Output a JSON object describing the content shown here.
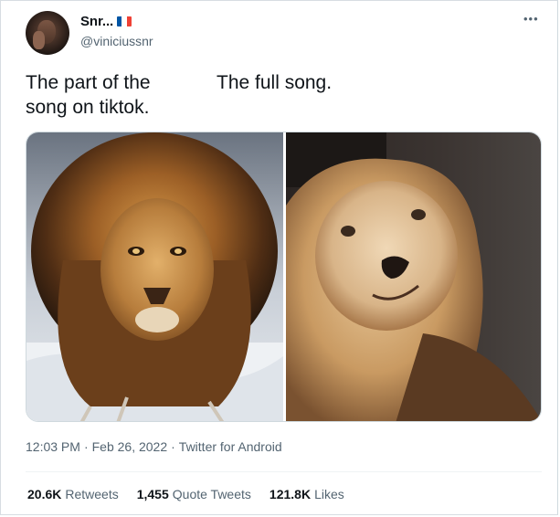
{
  "author": {
    "display_name": "Snr...",
    "handle": "@viniciussnr",
    "flag_colors": [
      "#0055a4",
      "#ffffff",
      "#ef4135"
    ]
  },
  "tweet": {
    "left_caption": "The part of the song on tiktok.",
    "right_caption": "The full song."
  },
  "media": {
    "left_image": "majestic-lion-photo",
    "right_image": "taxidermy-lion-photo"
  },
  "meta": {
    "time": "12:03 PM",
    "separator": "·",
    "date": "Feb 26, 2022",
    "source": "Twitter for Android"
  },
  "stats": {
    "retweets_count": "20.6K",
    "retweets_label": "Retweets",
    "quotes_count": "1,455",
    "quotes_label": "Quote Tweets",
    "likes_count": "121.8K",
    "likes_label": "Likes"
  },
  "icons": {
    "more": "more-options-icon"
  },
  "colors": {
    "text_primary": "#0f1419",
    "text_secondary": "#536471",
    "border": "#cfd9de"
  }
}
